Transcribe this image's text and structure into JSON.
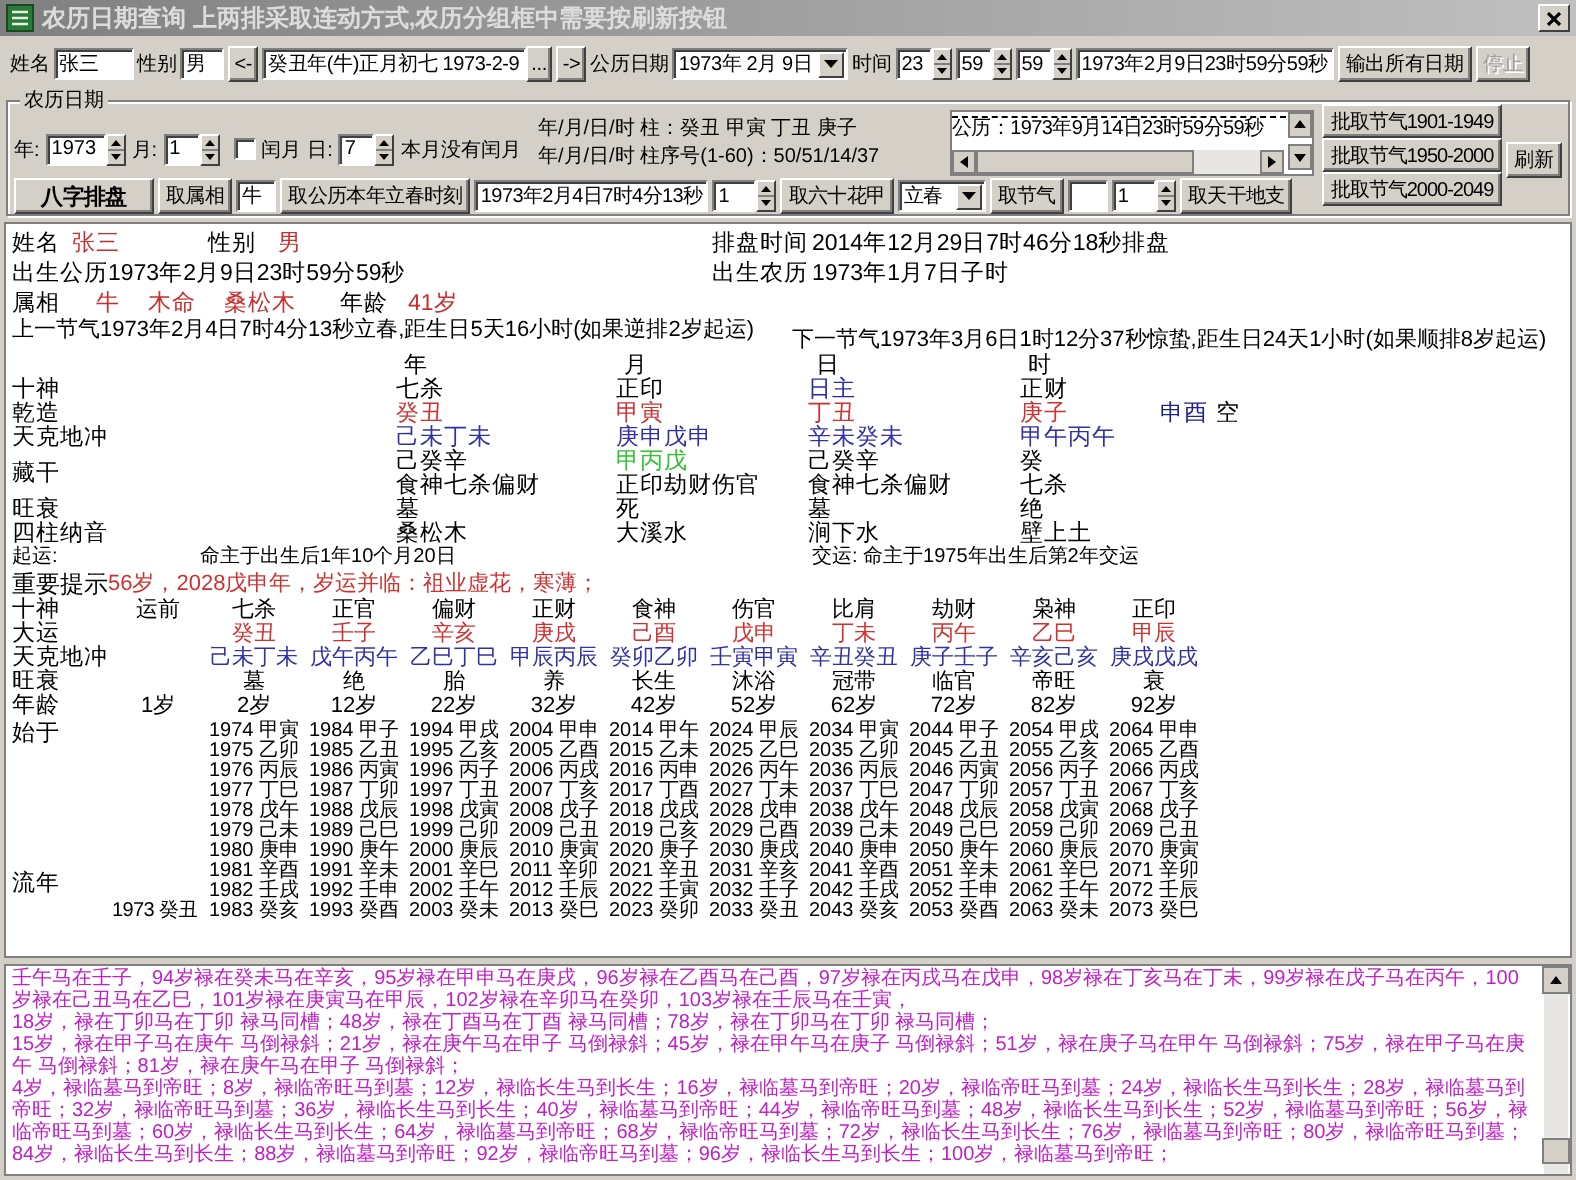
{
  "window": {
    "title": "农历日期查询 上两排采取连动方式,农历分组框中需要按刷新按钮"
  },
  "form": {
    "name_label": "姓名",
    "name_value": "张三",
    "gender_label": "性别",
    "gender_value": "男",
    "prev_button": "<-",
    "lunar_value": "癸丑年(牛)正月初七 1973-2-9",
    "browse_button": "...",
    "next_button": "->",
    "solar_label": "公历日期",
    "solar_value": "1973年 2月 9日",
    "time_label": "时间",
    "hour": "23",
    "minute": "59",
    "second": "59",
    "datetime_value": "1973年2月9日23时59分59秒",
    "buttons": [
      {
        "label": "输出所有日期",
        "disabled": false
      },
      {
        "label": "停止",
        "disabled": true
      }
    ]
  },
  "lunar_group": {
    "title": "农历日期",
    "year_label": "年:",
    "year": "1973",
    "month_label": "月:",
    "month": "1",
    "leap": {
      "label": "闰月",
      "checked": false
    },
    "day_label": "日:",
    "day": "7",
    "leap_note": "本月没有闰月",
    "pillars_line": "年/月/日/时 柱：癸丑 甲寅 丁丑 庚子",
    "index_line": "年/月/日/时 柱序号(1-60)：50/51/14/37",
    "list_items": [
      "公历：1973年9月14日23时59分59秒"
    ],
    "batch_buttons": [
      "批取节气1901-1949",
      "批取节气1950-2000",
      "批取节气2000-2049"
    ],
    "refresh_button": "刷新"
  },
  "toolbar": {
    "paipan_button": "八字排盘",
    "zodiac_button": "取属相",
    "zodiac_value": "牛",
    "lichun_button": "取公历本年立春时刻",
    "lichun_value": "1973年2月4日7时4分13秒",
    "lichun_spin": "1",
    "jiazi_button": "取六十花甲",
    "term_select": "立春",
    "term_button": "取节气",
    "term_spin": "1",
    "ganzhi_button": "取天干地支"
  },
  "chart": {
    "name": {
      "label": "姓名",
      "value": "张三"
    },
    "gender": {
      "label": "性别",
      "value": "男"
    },
    "paipan_time": {
      "label": "排盘时间",
      "value": "2014年12月29日7时46分18秒排盘"
    },
    "birth_solar": "出生公历1973年2月9日23时59分59秒",
    "birth_lunar": {
      "label": "出生农历",
      "value": "1973年1月7日子时"
    },
    "zodiac": {
      "label": "属相",
      "values": [
        "牛",
        "木命",
        "桑松木"
      ]
    },
    "age": {
      "label": "年龄",
      "value": "41岁"
    },
    "prev_term": "上一节气1973年2月4日7时4分13秒立春,距生日5天16小时(如果逆排2岁起运)",
    "next_term": "下一节气1973年3月6日1时12分37秒惊蛰,距生日24天1小时(如果顺排8岁起运)",
    "pillar_headers": [
      "年",
      "月",
      "日",
      "时"
    ],
    "pillar_rows": [
      {
        "label": "十神",
        "kind": "plain",
        "cells": [
          "七杀",
          "正印",
          {
            "text": "日主",
            "color": "#2828a8"
          },
          "正财"
        ]
      },
      {
        "label": "乾造",
        "kind": "stem",
        "cells": [
          "癸丑",
          "甲寅",
          "丁丑",
          "庚子"
        ],
        "void": {
          "branches": "申酉",
          "mark": "空"
        }
      },
      {
        "label": "天克地冲",
        "kind": "clash",
        "cells": [
          "己未丁未",
          "庚申戊申",
          "辛未癸未",
          "甲午丙午"
        ]
      },
      {
        "label": "藏干",
        "kind": "hidden",
        "cells": [
          "己癸辛",
          {
            "text": "甲丙戊",
            "color": "#30c030"
          },
          "己癸辛",
          "癸"
        ],
        "gods": [
          "食神七杀偏财",
          "正印劫财伤官",
          "食神七杀偏财",
          "七杀"
        ]
      },
      {
        "label": "旺衰",
        "kind": "plain",
        "cells": [
          "墓",
          "死",
          "墓",
          "绝"
        ]
      },
      {
        "label": "四柱纳音",
        "kind": "plain",
        "cells": [
          "桑松木",
          "大溪水",
          "涧下水",
          "壁上土"
        ]
      }
    ],
    "qiyun": {
      "label": "起运:",
      "text": "命主于出生后1年10个月20日",
      "jiaoyun": "交运: 命主于1975年出生后第2年交运"
    },
    "tip": {
      "label": "重要提示",
      "text": "56岁，2028戊申年，岁运并临：祖业虚花，寒薄；"
    },
    "dayun": {
      "shishen_label": "十神",
      "pre_label": "运前",
      "dayun_label": "大运",
      "clash_label": "天克地冲",
      "state_label": "旺衰",
      "age_label": "年龄",
      "pre_age": "1岁",
      "start_label": "始于",
      "liunian_label": "流年",
      "pre_year": "1973 癸丑",
      "columns": [
        {
          "shishen": "七杀",
          "stem": "癸丑",
          "clash": "己未丁未",
          "state": "墓",
          "age": "2岁",
          "years": [
            "1974 甲寅",
            "1975 乙卯",
            "1976 丙辰",
            "1977 丁巳",
            "1978 戊午",
            "1979 己未",
            "1980 庚申",
            "1981 辛酉",
            "1982 壬戌",
            "1983 癸亥"
          ]
        },
        {
          "shishen": "正官",
          "stem": "壬子",
          "clash": "戊午丙午",
          "state": "绝",
          "age": "12岁",
          "years": [
            "1984 甲子",
            "1985 乙丑",
            "1986 丙寅",
            "1987 丁卯",
            "1988 戊辰",
            "1989 己巳",
            "1990 庚午",
            "1991 辛未",
            "1992 壬申",
            "1993 癸酉"
          ]
        },
        {
          "shishen": "偏财",
          "stem": "辛亥",
          "clash": "乙巳丁巳",
          "state": "胎",
          "age": "22岁",
          "years": [
            "1994 甲戌",
            "1995 乙亥",
            "1996 丙子",
            "1997 丁丑",
            "1998 戊寅",
            "1999 己卯",
            "2000 庚辰",
            "2001 辛巳",
            "2002 壬午",
            "2003 癸未"
          ]
        },
        {
          "shishen": "正财",
          "stem": "庚戌",
          "clash": "甲辰丙辰",
          "state": "养",
          "age": "32岁",
          "years": [
            "2004 甲申",
            "2005 乙酉",
            "2006 丙戌",
            "2007 丁亥",
            "2008 戊子",
            "2009 己丑",
            "2010 庚寅",
            "2011 辛卯",
            "2012 壬辰",
            "2013 癸巳"
          ]
        },
        {
          "shishen": "食神",
          "stem": "己酉",
          "clash": "癸卯乙卯",
          "state": "长生",
          "age": "42岁",
          "years": [
            "2014 甲午",
            "2015 乙未",
            "2016 丙申",
            "2017 丁酉",
            "2018 戊戌",
            "2019 己亥",
            "2020 庚子",
            "2021 辛丑",
            "2022 壬寅",
            "2023 癸卯"
          ]
        },
        {
          "shishen": "伤官",
          "stem": "戊申",
          "clash": "壬寅甲寅",
          "state": "沐浴",
          "age": "52岁",
          "years": [
            "2024 甲辰",
            "2025 乙巳",
            "2026 丙午",
            "2027 丁未",
            "2028 戊申",
            "2029 己酉",
            "2030 庚戌",
            "2031 辛亥",
            "2032 壬子",
            "2033 癸丑"
          ]
        },
        {
          "shishen": "比肩",
          "stem": "丁未",
          "clash": "辛丑癸丑",
          "state": "冠带",
          "age": "62岁",
          "years": [
            "2034 甲寅",
            "2035 乙卯",
            "2036 丙辰",
            "2037 丁巳",
            "2038 戊午",
            "2039 己未",
            "2040 庚申",
            "2041 辛酉",
            "2042 壬戌",
            "2043 癸亥"
          ]
        },
        {
          "shishen": "劫财",
          "stem": "丙午",
          "clash": "庚子壬子",
          "state": "临官",
          "age": "72岁",
          "years": [
            "2044 甲子",
            "2045 乙丑",
            "2046 丙寅",
            "2047 丁卯",
            "2048 戊辰",
            "2049 己巳",
            "2050 庚午",
            "2051 辛未",
            "2052 壬申",
            "2053 癸酉"
          ]
        },
        {
          "shishen": "枭神",
          "stem": "乙巳",
          "clash": "辛亥己亥",
          "state": "帝旺",
          "age": "82岁",
          "years": [
            "2054 甲戌",
            "2055 乙亥",
            "2056 丙子",
            "2057 丁丑",
            "2058 戊寅",
            "2059 己卯",
            "2060 庚辰",
            "2061 辛巳",
            "2062 壬午",
            "2063 癸未"
          ]
        },
        {
          "shishen": "正印",
          "stem": "甲辰",
          "clash": "庚戌戊戌",
          "state": "衰",
          "age": "92岁",
          "years": [
            "2064 甲申",
            "2065 乙酉",
            "2066 丙戌",
            "2067 丁亥",
            "2068 戊子",
            "2069 己丑",
            "2070 庚寅",
            "2071 辛卯",
            "2072 壬辰",
            "2073 癸巳"
          ]
        }
      ]
    }
  },
  "notes": [
    "壬午马在壬子，94岁禄在癸未马在辛亥，95岁禄在甲申马在庚戌，96岁禄在乙酉马在己酉，97岁禄在丙戌马在戊申，98岁禄在丁亥马在丁未，99岁禄在戊子马在丙午，100岁禄在己丑马在乙巳，101岁禄在庚寅马在甲辰，102岁禄在辛卯马在癸卯，103岁禄在壬辰马在壬寅，",
    "18岁，禄在丁卯马在丁卯 禄马同槽；48岁，禄在丁酉马在丁酉 禄马同槽；78岁，禄在丁卯马在丁卯 禄马同槽；",
    "15岁，禄在甲子马在庚午 马倒禄斜；21岁，禄在庚午马在甲子 马倒禄斜；45岁，禄在甲午马在庚子 马倒禄斜；51岁，禄在庚子马在甲午 马倒禄斜；75岁，禄在甲子马在庚午 马倒禄斜；81岁，禄在庚午马在甲子 马倒禄斜；",
    "4岁，禄临墓马到帝旺；8岁，禄临帝旺马到墓；12岁，禄临长生马到长生；16岁，禄临墓马到帝旺；20岁，禄临帝旺马到墓；24岁，禄临长生马到长生；28岁，禄临墓马到帝旺；32岁，禄临帝旺马到墓；36岁，禄临长生马到长生；40岁，禄临墓马到帝旺；44岁，禄临帝旺马到墓；48岁，禄临长生马到长生；52岁，禄临墓马到帝旺；56岁，禄临帝旺马到墓；60岁，禄临长生马到长生；64岁，禄临墓马到帝旺；68岁，禄临帝旺马到墓；72岁，禄临长生马到长生；76岁，禄临墓马到帝旺；80岁，禄临帝旺马到墓；84岁，禄临长生马到长生；88岁，禄临墓马到帝旺；92岁，禄临帝旺马到墓；96岁，禄临长生马到长生；100岁，禄临墓马到帝旺；"
  ]
}
